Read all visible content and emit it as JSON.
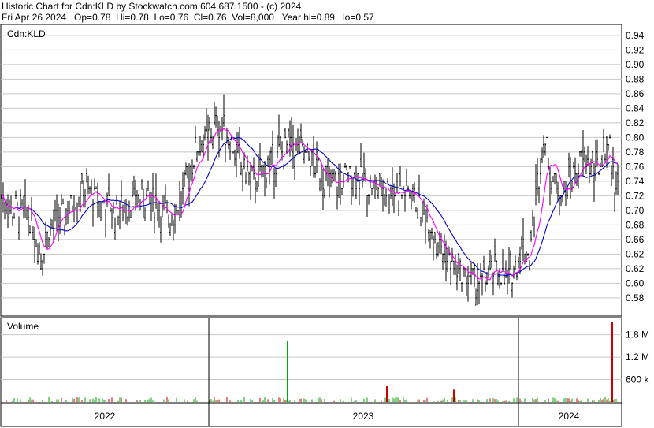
{
  "header": {
    "line1": "Historic Chart for Cdn:KLD by Stockwatch.com 604.687.1500 - (c) 2024",
    "line2": "Fri Apr 26 2024   Op=0.78  Hi=0.78  Lo=0.76  Cl=0.76  Vol=8,000   Year hi=0.89   lo=0.57"
  },
  "chart_data": [
    {
      "type": "line",
      "subtype": "ohlc-bars",
      "title": "Cdn:KLD",
      "ylim": [
        0.555,
        0.955
      ],
      "yticks": [
        "0.94",
        "0.92",
        "0.90",
        "0.88",
        "0.86",
        "0.84",
        "0.82",
        "0.80",
        "0.78",
        "0.76",
        "0.74",
        "0.72",
        "0.70",
        "0.68",
        "0.66",
        "0.62",
        "0.62",
        "0.60",
        "0.58"
      ],
      "ytick_values": [
        0.94,
        0.92,
        0.9,
        0.88,
        0.86,
        0.84,
        0.82,
        0.8,
        0.78,
        0.76,
        0.74,
        0.72,
        0.7,
        0.68,
        0.66,
        0.64,
        0.62,
        0.6,
        0.58
      ],
      "x_years": [
        "2022",
        "2023",
        "2024"
      ],
      "price_anchors": [
        [
          0,
          0.72
        ],
        [
          12,
          0.7
        ],
        [
          25,
          0.7
        ],
        [
          35,
          0.69
        ],
        [
          50,
          0.64
        ],
        [
          62,
          0.68
        ],
        [
          75,
          0.69
        ],
        [
          90,
          0.71
        ],
        [
          105,
          0.73
        ],
        [
          125,
          0.71
        ],
        [
          145,
          0.7
        ],
        [
          165,
          0.71
        ],
        [
          185,
          0.72
        ],
        [
          200,
          0.7
        ],
        [
          215,
          0.69
        ],
        [
          230,
          0.72
        ],
        [
          245,
          0.78
        ],
        [
          260,
          0.8
        ],
        [
          275,
          0.82
        ],
        [
          290,
          0.8
        ],
        [
          305,
          0.76
        ],
        [
          320,
          0.74
        ],
        [
          335,
          0.76
        ],
        [
          350,
          0.77
        ],
        [
          365,
          0.79
        ],
        [
          380,
          0.78
        ],
        [
          395,
          0.77
        ],
        [
          410,
          0.74
        ],
        [
          425,
          0.73
        ],
        [
          440,
          0.75
        ],
        [
          460,
          0.74
        ],
        [
          480,
          0.73
        ],
        [
          500,
          0.73
        ],
        [
          520,
          0.72
        ],
        [
          535,
          0.7
        ],
        [
          548,
          0.67
        ],
        [
          560,
          0.64
        ],
        [
          575,
          0.62
        ],
        [
          590,
          0.61
        ],
        [
          605,
          0.6
        ],
        [
          620,
          0.61
        ],
        [
          630,
          0.62
        ],
        [
          640,
          0.6
        ],
        [
          650,
          0.62
        ],
        [
          660,
          0.65
        ],
        [
          670,
          0.64
        ],
        [
          678,
          0.72
        ],
        [
          688,
          0.8
        ],
        [
          700,
          0.74
        ],
        [
          712,
          0.72
        ],
        [
          725,
          0.75
        ],
        [
          740,
          0.77
        ],
        [
          755,
          0.75
        ],
        [
          770,
          0.8
        ],
        [
          778,
          0.73
        ],
        [
          784,
          0.76
        ]
      ],
      "volume_panel": {
        "title": "Volume",
        "ylim": [
          0,
          2150000
        ],
        "yticks": [
          "1.8 M",
          "1.2 M",
          "600 k"
        ],
        "ytick_values": [
          1800000,
          1200000,
          600000
        ],
        "spikes": [
          {
            "x": 365,
            "volume": 1640000,
            "color": "#00aa00"
          },
          {
            "x": 491,
            "volume": 420000,
            "color": "#cc0000"
          },
          {
            "x": 576,
            "volume": 330000,
            "color": "#cc0000"
          },
          {
            "x": 777,
            "volume": 2150000,
            "color": "#cc0000"
          }
        ]
      },
      "colors": {
        "bars": "#000000",
        "ma_short": "#ff00ff",
        "ma_long": "#0000cc",
        "volume_up": "#00aa00",
        "volume_down": "#cc0000",
        "grid": "#c8c8c8"
      }
    }
  ]
}
